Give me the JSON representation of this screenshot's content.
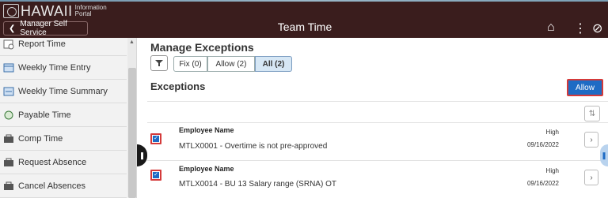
{
  "header": {
    "logo_text": "HAWAII",
    "logo_sub": "Information Portal",
    "back_label": "Manager Self Service",
    "title": "Team Time",
    "icons": [
      "home-icon",
      "more-vert-icon",
      "navigation-icon"
    ]
  },
  "sidebar": {
    "items": [
      {
        "label": "Report Time",
        "icon": "report-time-icon"
      },
      {
        "label": "Weekly Time Entry",
        "icon": "weekly-entry-icon"
      },
      {
        "label": "Weekly Time Summary",
        "icon": "weekly-summary-icon"
      },
      {
        "label": "Payable Time",
        "icon": "payable-time-icon"
      },
      {
        "label": "Comp Time",
        "icon": "comp-time-icon"
      },
      {
        "label": "Request Absence",
        "icon": "request-absence-icon"
      },
      {
        "label": "Cancel Absences",
        "icon": "cancel-absences-icon"
      }
    ]
  },
  "main": {
    "title": "Manage Exceptions",
    "segments": [
      {
        "label": "Fix (0)",
        "selected": false
      },
      {
        "label": "Allow (2)",
        "selected": false
      },
      {
        "label": "All (2)",
        "selected": true
      }
    ],
    "section_title": "Exceptions",
    "allow_label": "Allow",
    "rows": [
      {
        "employee_label": "Employee Name",
        "description": "MTLX0001 - Overtime is not pre-approved",
        "severity": "High",
        "date": "09/16/2022",
        "checked": true
      },
      {
        "employee_label": "Employee Name",
        "description": "MTLX0014 - BU 13 Salary range (SRNA) OT",
        "severity": "High",
        "date": "09/16/2022",
        "checked": true
      }
    ]
  },
  "colors": {
    "header_bg": "#3a1d1d",
    "accent": "#1e6bc4",
    "highlight": "#d43a3a"
  }
}
